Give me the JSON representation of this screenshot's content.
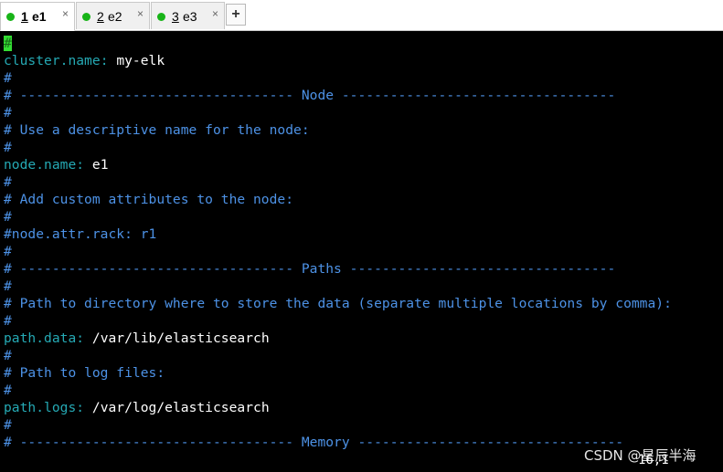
{
  "tabs": [
    {
      "number": "1",
      "name": "e1",
      "close": "×",
      "active": true
    },
    {
      "number": "2",
      "name": "e2",
      "close": "×",
      "active": false
    },
    {
      "number": "3",
      "name": "e3",
      "close": "×",
      "active": false
    }
  ],
  "new_tab_label": "+",
  "cursor_char": "#",
  "lines": [
    {
      "k": "",
      "v": "",
      "c": ""
    },
    {
      "k": "cluster.name",
      "v": ": ",
      "c": "my-elk"
    },
    {
      "k": "",
      "v": "#",
      "c": ""
    },
    {
      "k": "",
      "v": "# ---------------------------------- Node ----------------------------------",
      "c": ""
    },
    {
      "k": "",
      "v": "#",
      "c": ""
    },
    {
      "k": "",
      "v": "# Use a descriptive name for the node:",
      "c": ""
    },
    {
      "k": "",
      "v": "#",
      "c": ""
    },
    {
      "k": "node.name",
      "v": ": ",
      "c": "e1"
    },
    {
      "k": "",
      "v": "#",
      "c": ""
    },
    {
      "k": "",
      "v": "# Add custom attributes to the node:",
      "c": ""
    },
    {
      "k": "",
      "v": "#",
      "c": ""
    },
    {
      "k": "",
      "v": "#node.attr.rack: r1",
      "c": ""
    },
    {
      "k": "",
      "v": "#",
      "c": ""
    },
    {
      "k": "",
      "v": "# ---------------------------------- Paths ---------------------------------",
      "c": ""
    },
    {
      "k": "",
      "v": "#",
      "c": ""
    },
    {
      "k": "",
      "v": "# Path to directory where to store the data (separate multiple locations by comma):",
      "c": ""
    },
    {
      "k": "",
      "v": "#",
      "c": ""
    },
    {
      "k": "path.data",
      "v": ": ",
      "c": "/var/lib/elasticsearch"
    },
    {
      "k": "",
      "v": "#",
      "c": ""
    },
    {
      "k": "",
      "v": "# Path to log files:",
      "c": ""
    },
    {
      "k": "",
      "v": "#",
      "c": ""
    },
    {
      "k": "path.logs",
      "v": ": ",
      "c": "/var/log/elasticsearch"
    },
    {
      "k": "",
      "v": "#",
      "c": ""
    },
    {
      "k": "",
      "v": "# ---------------------------------- Memory ---------------------------------",
      "c": ""
    }
  ],
  "status_position": "16,1",
  "watermark": "CSDN @星辰半海",
  "colors": {
    "comment": "#4d92e6",
    "key": "#25a9b4",
    "value": "#ffffff",
    "cursor": "#33dd33",
    "tab_dot": "#18b418"
  }
}
